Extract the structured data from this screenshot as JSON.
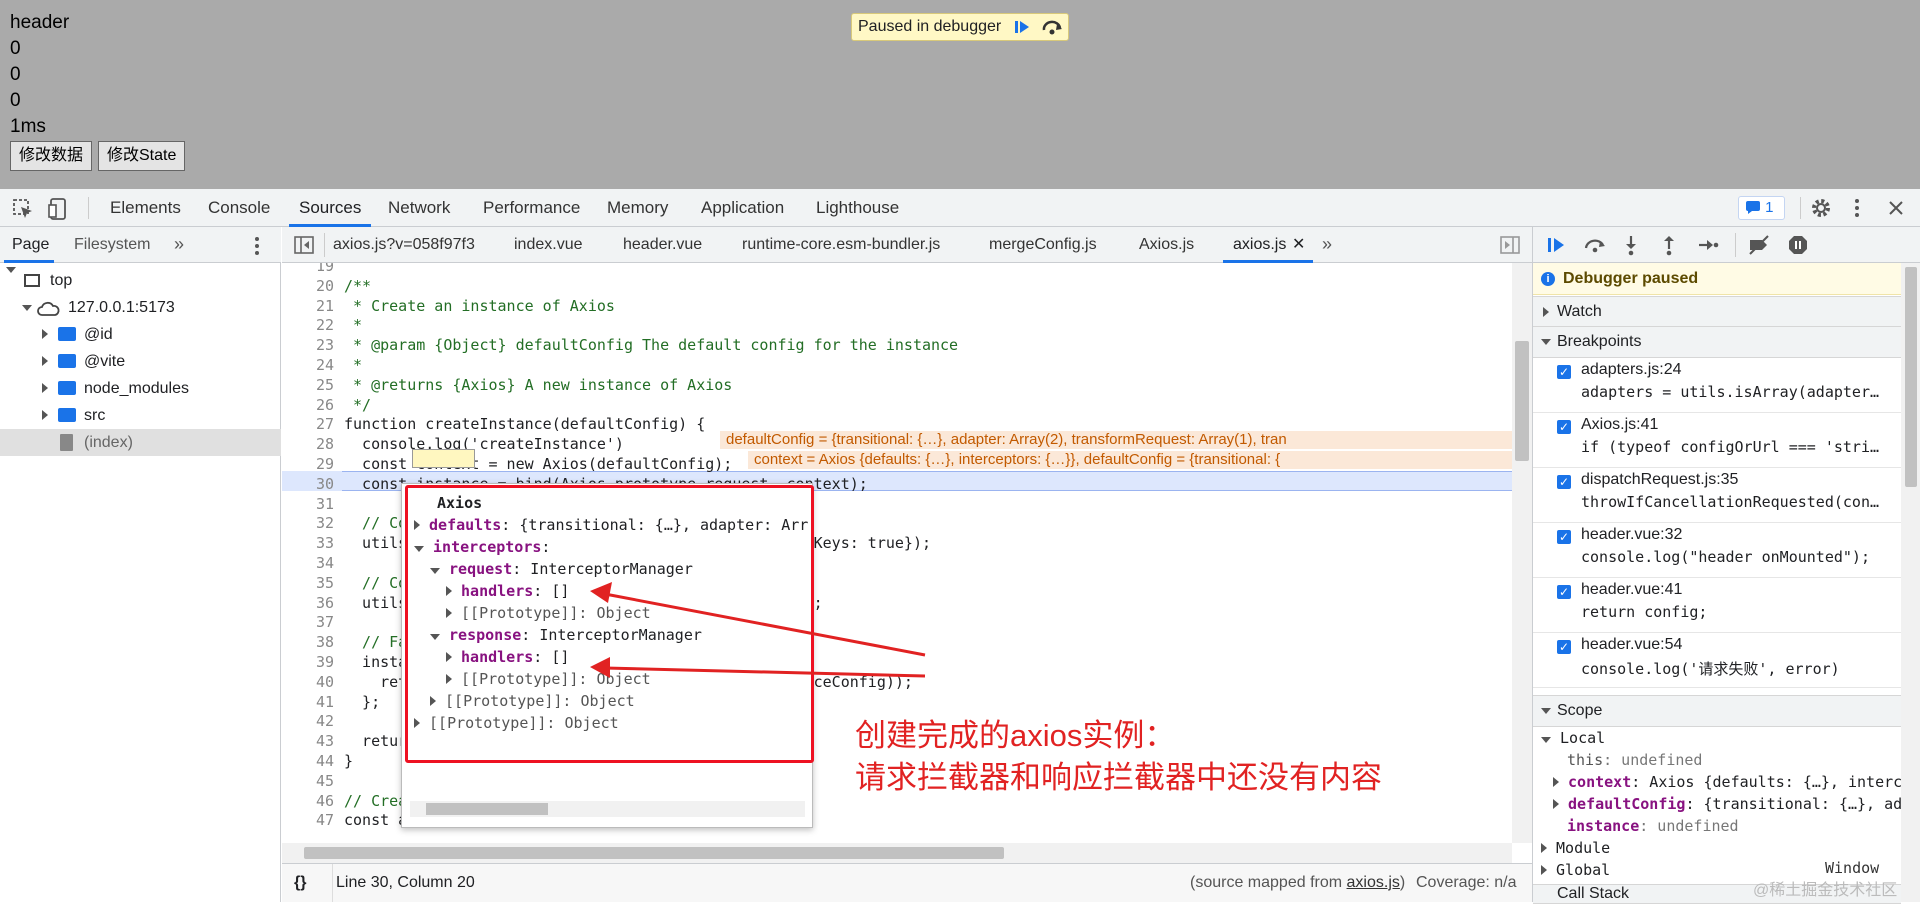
{
  "page": {
    "lines": [
      "header",
      "0",
      "0",
      "0",
      "1ms"
    ],
    "buttons": [
      "修改数据",
      "修改State"
    ],
    "paused_text": "Paused in debugger"
  },
  "toolbar": {
    "tabs": [
      "Elements",
      "Console",
      "Sources",
      "Network",
      "Performance",
      "Memory",
      "Application",
      "Lighthouse"
    ],
    "active_tab": "Sources",
    "issues_count": "1"
  },
  "sidebar": {
    "tabs": [
      "Page",
      "Filesystem"
    ],
    "more": "»",
    "tree": [
      "top",
      "127.0.0.1:5173",
      "@id",
      "@vite",
      "node_modules",
      "src",
      "(index)"
    ]
  },
  "editor_tabs": [
    "axios.js?v=058f97f3",
    "index.vue",
    "header.vue",
    "runtime-core.esm-bundler.js",
    "mergeConfig.js",
    "Axios.js",
    "axios.js"
  ],
  "code": [
    {
      "n": "19",
      "t": ""
    },
    {
      "n": "20",
      "t": "/**"
    },
    {
      "n": "21",
      "t": " * Create an instance of Axios"
    },
    {
      "n": "22",
      "t": " *"
    },
    {
      "n": "23",
      "t": " * @param {Object} defaultConfig The default config for the instance"
    },
    {
      "n": "24",
      "t": " *"
    },
    {
      "n": "25",
      "t": " * @returns {Axios} A new instance of Axios"
    },
    {
      "n": "26",
      "t": " */"
    },
    {
      "n": "27",
      "t": "function createInstance(defaultConfig) {"
    },
    {
      "n": "28",
      "t": "  console.log('createInstance')"
    },
    {
      "n": "29",
      "t": "  const context = new Axios(defaultConfig);"
    },
    {
      "n": "30",
      "t": "  const instance = bind(Axios.prototype.request, context);"
    },
    {
      "n": "31",
      "t": ""
    },
    {
      "n": "32",
      "t": "  // Co"
    },
    {
      "n": "33",
      "t": "  utils                                       allOwnKeys: true});"
    },
    {
      "n": "34",
      "t": ""
    },
    {
      "n": "35",
      "t": "  // Co"
    },
    {
      "n": "36",
      "t": "  utils                                       true});"
    },
    {
      "n": "37",
      "t": ""
    },
    {
      "n": "38",
      "t": "  // Fa"
    },
    {
      "n": "39",
      "t": "  insta                                      {"
    },
    {
      "n": "40",
      "t": "    ret                                       instanceConfig));"
    },
    {
      "n": "41",
      "t": "  };"
    },
    {
      "n": "42",
      "t": ""
    },
    {
      "n": "43",
      "t": "  retur"
    },
    {
      "n": "44",
      "t": "}"
    },
    {
      "n": "45",
      "t": ""
    },
    {
      "n": "46",
      "t": "// Crea"
    },
    {
      "n": "47",
      "t": "const axios = createInstance(defaults);"
    }
  ],
  "inline_values": {
    "l27": "defaultConfig = {transitional: {…}, adapter: Array(2), transformRequest: Array(1), tran",
    "l29": "context = Axios {defaults: {…}, interceptors: {…}}, defaultConfig = {transitional: {"
  },
  "popover": {
    "title": "Axios",
    "rows": [
      {
        "k": "defaults",
        "v": ": {transitional: {…}, adapter: Arr"
      },
      {
        "k": "interceptors",
        "v": ":"
      },
      {
        "k": "request",
        "v": ": InterceptorManager"
      },
      {
        "k": "handlers",
        "v": ": []"
      },
      {
        "k": "",
        "v": "[[Prototype]]: Object"
      },
      {
        "k": "response",
        "v": ": InterceptorManager"
      },
      {
        "k": "handlers",
        "v": ": []"
      },
      {
        "k": "",
        "v": "[[Prototype]]: Object"
      },
      {
        "k": "",
        "v": "[[Prototype]]: Object"
      },
      {
        "k": "",
        "v": "[[Prototype]]: Object"
      }
    ]
  },
  "annotation": [
    "创建完成的axios实例：",
    "请求拦截器和响应拦截器中还没有内容"
  ],
  "status": {
    "position": "Line 30, Column 20",
    "source_mapped": "(source mapped from ",
    "source_file": "axios.js",
    "source_end": ")",
    "coverage": "Coverage: n/a"
  },
  "right": {
    "paused": "Debugger paused",
    "watch": "Watch",
    "breakpoints_title": "Breakpoints",
    "breakpoints": [
      {
        "file": "adapters.js:24",
        "code": "adapters = utils.isArray(adapter…"
      },
      {
        "file": "Axios.js:41",
        "code": "if (typeof configOrUrl === 'stri…"
      },
      {
        "file": "dispatchRequest.js:35",
        "code": "throwIfCancellationRequested(con…"
      },
      {
        "file": "header.vue:32",
        "code": "console.log(\"header onMounted\");"
      },
      {
        "file": "header.vue:41",
        "code": "return config;"
      },
      {
        "file": "header.vue:54",
        "code": "console.log('请求失败', error)"
      }
    ],
    "scope_title": "Scope",
    "local": "Local",
    "scope_rows": [
      {
        "k": "this",
        "v": ": undefined"
      },
      {
        "k": "context",
        "v": ": Axios {defaults: {…}, interc"
      },
      {
        "k": "defaultConfig",
        "v": ": {transitional: {…}, ad"
      },
      {
        "k": "instance",
        "v": ": undefined"
      }
    ],
    "module": "Module",
    "global": "Global",
    "global_val": "Window",
    "callstack": "Call Stack"
  },
  "watermark": "@稀土掘金技术社区",
  "colors": {
    "accent": "#1a73e8",
    "annotation": "#e12222",
    "inline_bg": "#fbe8d8"
  }
}
